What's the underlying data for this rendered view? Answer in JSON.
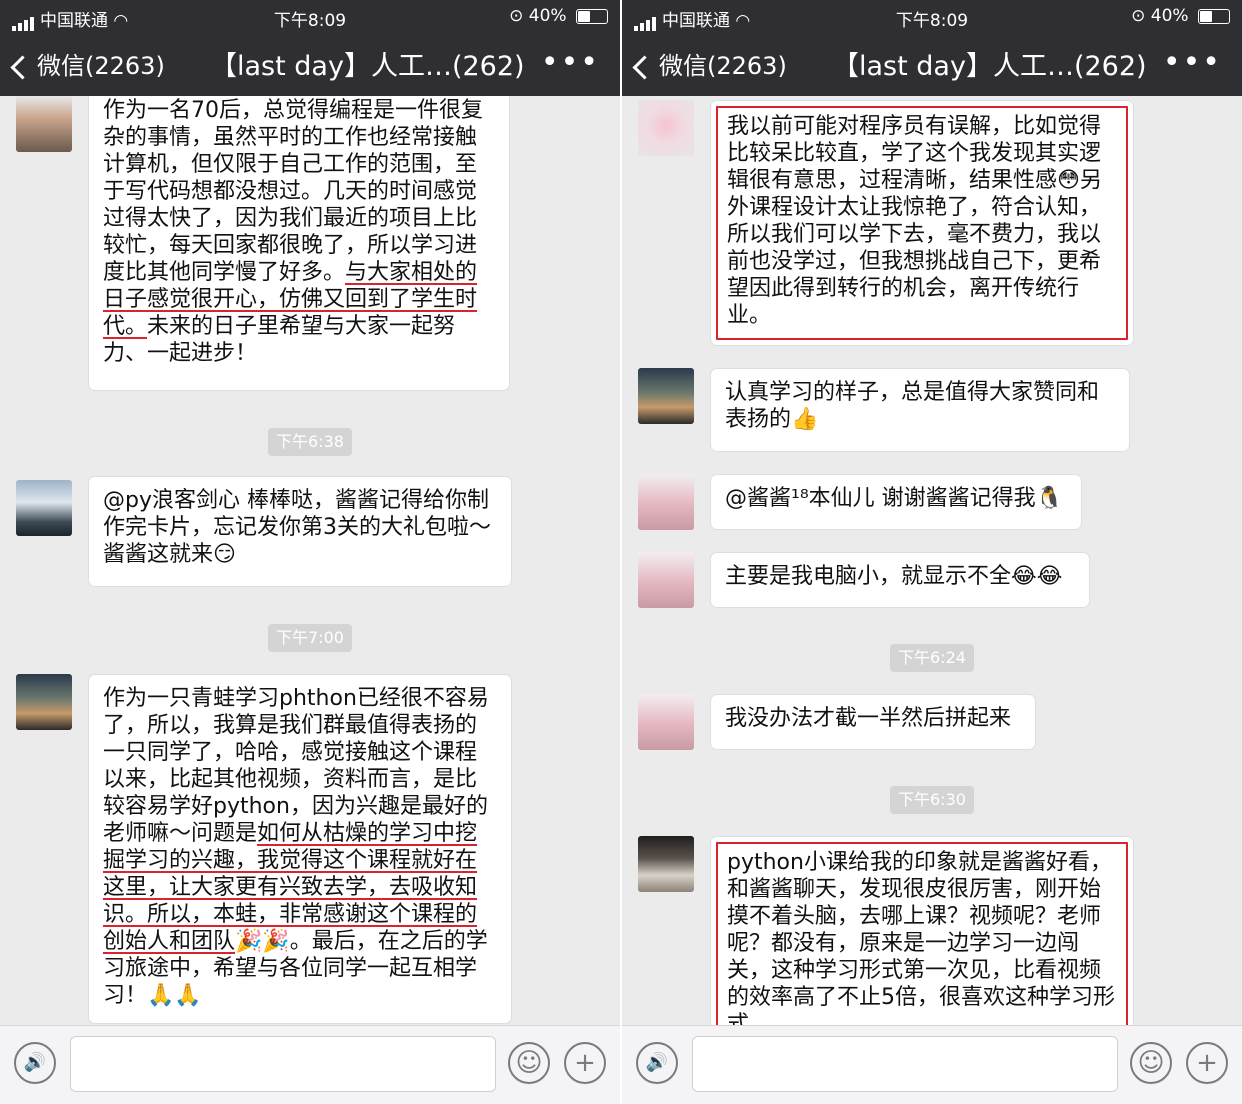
{
  "status": {
    "carrier": "中国联通",
    "time": "下午8:09",
    "battery": "40%",
    "battery_level": 0.4
  },
  "nav": {
    "back_label": "微信(2263)",
    "title": "【last day】人工…(262)",
    "more": "•••"
  },
  "left": {
    "messages": [
      {
        "text_a": "作为一名70后，总觉得编程是一件很复杂的事情，虽然平时的工作也经常接触计算机，但仅限于自己工作的范围，至于写代码想都没想过。几天的时间感觉过得太快了，因为我们最近的项目上比较忙，每天回家都很晚了，所以学习进度比其他同学慢了好多。",
        "text_ul": "与大家相处的日子感觉很开心，仿佛又回到了学生时代。",
        "text_b": "未来的日子里希望与大家一起努力、一起进步！"
      },
      {
        "text": "@py浪客剑心 棒棒哒，酱酱记得给你制作完卡片，忘记发你第3关的大礼包啦～酱酱这就来😏"
      },
      {
        "text_a": "作为一只青蛙学习phthon已经很不容易了，所以，我算是我们群最值得表扬的一只同学了，哈哈，感觉接触这个课程以来，比起其他视频，资料而言，是比较容易学好python，因为兴趣是最好的老师嘛～问题是",
        "text_ul": "如何从枯燥的学习中挖掘学习的兴趣，我觉得这个课程就好在这里，让大家更有兴致去学，去吸收知识。所以，本蛙，非常感谢这个课程的创始人和团队",
        "text_b": "🎉🎉。最后，在之后的学习旅途中，希望与各位同学一起互相学习！🙏🙏"
      }
    ],
    "timestamps": [
      "下午6:38",
      "下午7:00"
    ]
  },
  "right": {
    "messages": [
      {
        "text": "我以前可能对程序员有误解，比如觉得比较呆比较直，学了这个我发现其实逻辑很有意思，过程清晰，结果性感😳另外课程设计太让我惊艳了，符合认知，所以我们可以学下去，毫不费力，我以前也没学过，但我想挑战自己下，更希望因此得到转行的机会，离开传统行业。"
      },
      {
        "text": "认真学习的样子，总是值得大家赞同和表扬的👍"
      },
      {
        "text": "@酱酱¹⁸本仙儿 谢谢酱酱记得我🐧"
      },
      {
        "text": "主要是我电脑小，就显示不全😂😂"
      },
      {
        "text": "我没办法才截一半然后拼起来"
      },
      {
        "text": "python小课给我的印象就是酱酱好看，和酱酱聊天，发现很皮很厉害，刚开始摸不着头脑，去哪上课？视频呢？老师呢？都没有，原来是一边学习一边闯关，这种学习形式第一次见，比看视频的效率高了不止5倍，很喜欢这种学习形式"
      }
    ],
    "timestamps": [
      "下午6:24",
      "下午6:30"
    ]
  },
  "input": {
    "voice": "🔊",
    "emoji": "☺",
    "plus": "+"
  },
  "colors": {
    "nav_bg": "#2f2f33",
    "chat_bg": "#ebebeb",
    "highlight": "#d9232d"
  }
}
